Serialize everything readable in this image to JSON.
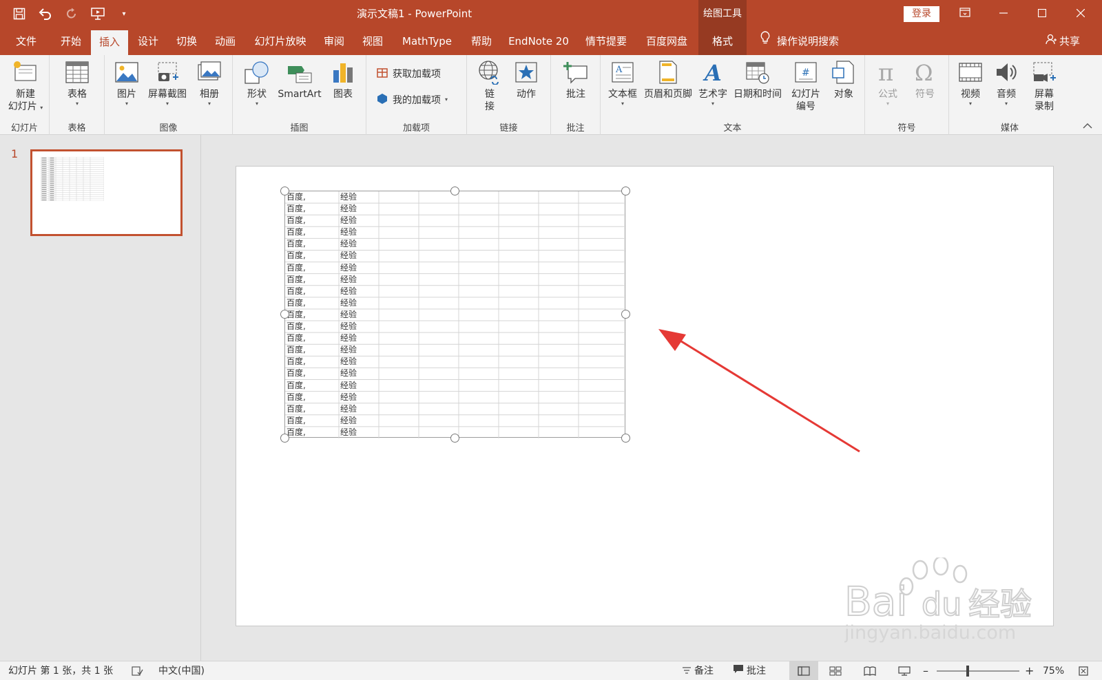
{
  "window": {
    "title": "演示文稿1  -  PowerPoint",
    "context_header": "绘图工具",
    "login_label": "登录",
    "controls": [
      "ribbon-display-icon",
      "minimize-icon",
      "maximize-icon",
      "close-icon"
    ]
  },
  "quick_access": {
    "items": [
      "save-icon",
      "undo-icon",
      "redo-icon",
      "present-from-start-icon",
      "customize-qat-icon"
    ]
  },
  "tabs": [
    {
      "label": "文件"
    },
    {
      "label": "开始"
    },
    {
      "label": "插入",
      "active": true
    },
    {
      "label": "设计"
    },
    {
      "label": "切换"
    },
    {
      "label": "动画"
    },
    {
      "label": "幻灯片放映"
    },
    {
      "label": "审阅"
    },
    {
      "label": "视图"
    },
    {
      "label": "MathType"
    },
    {
      "label": "帮助"
    },
    {
      "label": "EndNote 20"
    },
    {
      "label": "情节提要"
    },
    {
      "label": "百度网盘"
    },
    {
      "label": "格式",
      "contextual": true
    }
  ],
  "tell_me": "操作说明搜索",
  "share_label": "共享",
  "ribbon": {
    "groups": {
      "slides": "幻灯片",
      "tables": "表格",
      "images": "图像",
      "illustrations": "插图",
      "addins": "加载项",
      "links": "链接",
      "comments": "批注",
      "text": "文本",
      "symbols": "符号",
      "media": "媒体"
    },
    "buttons": {
      "new_slide_1": "新建",
      "new_slide_2": "幻灯片",
      "table": "表格",
      "pictures": "图片",
      "screenshot": "屏幕截图",
      "album": "相册",
      "shapes": "形状",
      "smartart": "SmartArt",
      "chart": "图表",
      "get_addins": "获取加载项",
      "my_addins": "我的加载项",
      "link_1": "链",
      "link_2": "接",
      "action": "动作",
      "comment": "批注",
      "textbox": "文本框",
      "header_footer": "页眉和页脚",
      "wordart": "艺术字",
      "datetime": "日期和时间",
      "slide_number_1": "幻灯片",
      "slide_number_2": "编号",
      "object": "对象",
      "equation": "公式",
      "symbol": "符号",
      "video": "视频",
      "audio": "音频",
      "screen_rec_1": "屏幕",
      "screen_rec_2": "录制"
    }
  },
  "thumbnail": {
    "number": "1"
  },
  "slide_table": {
    "rows": 21,
    "cols": 8,
    "col1": [
      "百度,",
      "百度,",
      "百度,",
      "百度,",
      "百度,",
      "百度,",
      "百度,",
      "百度,",
      "百度,",
      "百度,",
      "百度,",
      "百度,",
      "百度,",
      "百度,",
      "百度,",
      "百度,",
      "百度,",
      "百度,",
      "百度,",
      "百度,",
      "百度,"
    ],
    "col2": [
      "经验",
      "经验",
      "经验",
      "经验",
      "经验",
      "经验",
      "经验",
      "经验",
      "经验",
      "经验",
      "经验",
      "经验",
      "经验",
      "经验",
      "经验",
      "经验",
      "经验",
      "经验",
      "经验",
      "经验",
      "经验"
    ]
  },
  "annotation": {
    "arrow_color": "#e53935"
  },
  "watermark": {
    "brand": "Bai",
    "brand2": "du",
    "brand3": "经验",
    "url": "jingyan.baidu.com"
  },
  "statusbar": {
    "slide_info": "幻灯片 第 1 张，共 1 张",
    "language": "中文(中国)",
    "notes": "备注",
    "comments": "批注",
    "zoom": "75%"
  },
  "colors": {
    "accent": "#b7472a",
    "context": "#963a22"
  }
}
